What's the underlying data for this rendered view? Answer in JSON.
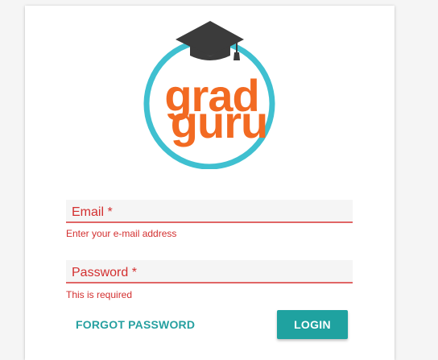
{
  "logo": {
    "line1": "grad",
    "line2": "guru",
    "ring_color": "#3fc0d0",
    "text_color": "#f26a22",
    "cap_color": "#3b3b3b"
  },
  "form": {
    "email": {
      "label": "Email",
      "required_mark": "*",
      "value": "",
      "error": "Enter your e-mail address"
    },
    "password": {
      "label": "Password",
      "required_mark": "*",
      "value": "",
      "error": "This is required"
    }
  },
  "actions": {
    "forgot": "FORGOT PASSWORD",
    "login": "LOGIN"
  },
  "colors": {
    "error": "#d32f2f",
    "accent": "#1fa2a0"
  }
}
